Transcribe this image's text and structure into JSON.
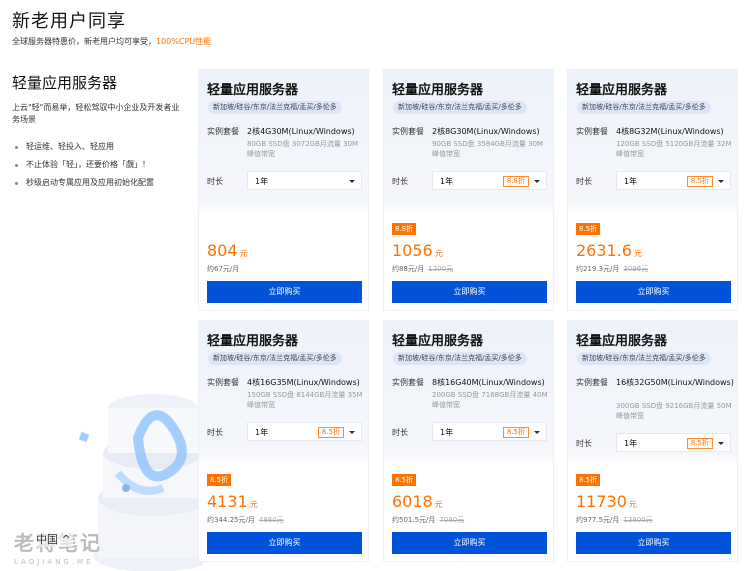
{
  "page": {
    "title": "新老用户同享",
    "subtitle_prefix": "全球服务器特惠价，新老用户均可享受，",
    "subtitle_highlight": "100%CPU性能"
  },
  "intro": {
    "heading": "轻量应用服务器",
    "description": "上云\"轻\"而易举，轻松驾驭中小企业及开发者业务场景",
    "bullets": [
      "轻运维、轻投入、轻应用",
      "不止体验「轻」，还要价格「覷」！",
      "秒级启动专属应用及应用初始化配置"
    ]
  },
  "watermark": {
    "main": "老蒋笔记",
    "sub": "LAOJIANG.ME",
    "overlay": "中国"
  },
  "labels": {
    "spec": "实例套餐",
    "duration": "时长",
    "buy": "立即购买",
    "currency": "元"
  },
  "cards": [
    {
      "name": "轻量应用服务器",
      "regions": "新加坡/硅谷/东京/法兰克福/孟买/多伦多",
      "spec": "2核4G30M(Linux/Windows)",
      "spec_desc": "80GB SSD盘 3072GB月流量 30M峰值带宽",
      "duration": "1年",
      "discount": "",
      "price": "804",
      "per_month": "约67元/月",
      "original": ""
    },
    {
      "name": "轻量应用服务器",
      "regions": "新加坡/硅谷/东京/法兰克福/孟买/多伦多",
      "spec": "2核8G30M(Linux/Windows)",
      "spec_desc": "90GB SSD盘 3584GB月流量 30M峰值带宽",
      "duration": "1年",
      "discount": "8.8折",
      "price": "1056",
      "per_month": "约88元/月",
      "original": "1200元"
    },
    {
      "name": "轻量应用服务器",
      "regions": "新加坡/硅谷/东京/法兰克福/孟买/多伦多",
      "spec": "4核8G32M(Linux/Windows)",
      "spec_desc": "120GB SSD盘 5120GB月流量 32M峰值带宽",
      "duration": "1年",
      "discount": "8.5折",
      "price": "2631.6",
      "per_month": "约219.3元/月",
      "original": "3096元"
    },
    {
      "name": "轻量应用服务器",
      "regions": "新加坡/硅谷/东京/法兰克福/孟买/多伦多",
      "spec": "4核16G35M(Linux/Windows)",
      "spec_desc": "150GB SSD盘 6144GB月流量 35M峰值带宽",
      "duration": "1年",
      "discount": "8.5折",
      "price": "4131",
      "per_month": "约344.25元/月",
      "original": "4860元"
    },
    {
      "name": "轻量应用服务器",
      "regions": "新加坡/硅谷/东京/法兰克福/孟买/多伦多",
      "spec": "8核16G40M(Linux/Windows)",
      "spec_desc": "200GB SSD盘 7168GB月流量 40M峰值带宽",
      "duration": "1年",
      "discount": "8.5折",
      "price": "6018",
      "per_month": "约501.5元/月",
      "original": "7080元"
    },
    {
      "name": "轻量应用服务器",
      "regions": "新加坡/硅谷/东京/法兰克福/孟买/多伦多",
      "spec": "16核32G50M(Linux/Windows)",
      "spec_desc": "300GB SSD盘 9216GB月流量 50M峰值带宽",
      "duration": "1年",
      "discount": "8.5折",
      "price": "11730",
      "per_month": "约977.5元/月",
      "original": "13800元"
    }
  ],
  "colors": {
    "accent": "#ff7200",
    "button": "#0052d9"
  }
}
